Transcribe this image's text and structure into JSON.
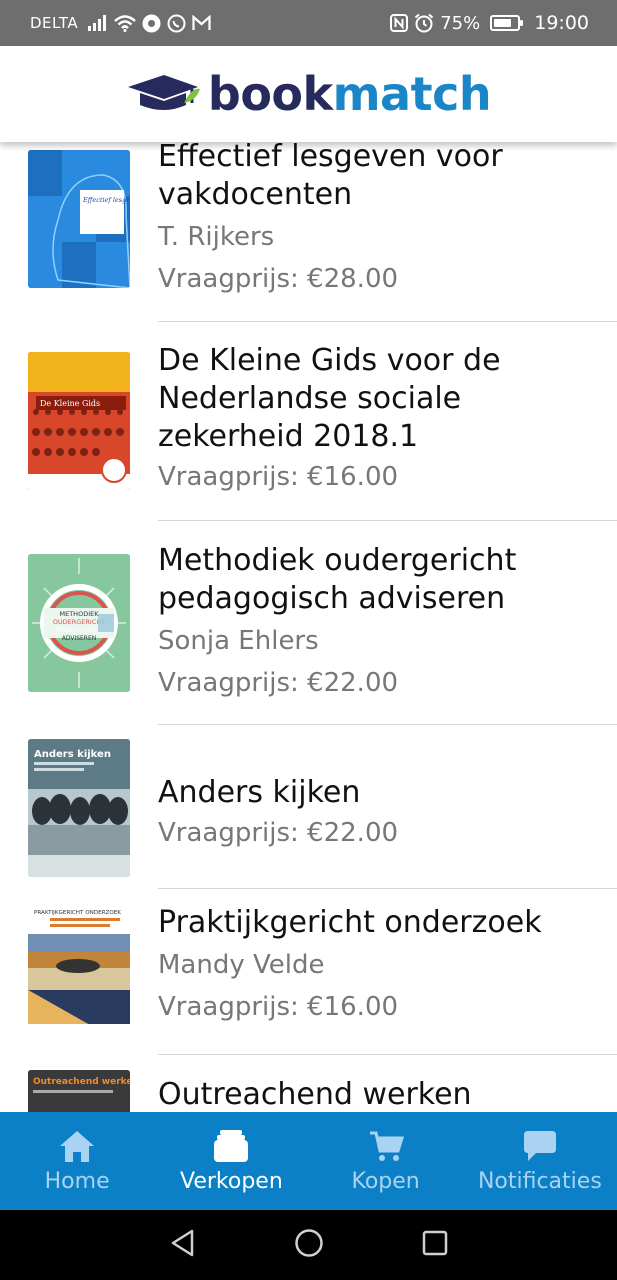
{
  "status_bar": {
    "carrier": "DELTA",
    "battery_percent": "75%",
    "battery_level": 0.75,
    "time": "19:00",
    "icons": [
      "signal-icon",
      "wifi-icon",
      "media-icon",
      "whatsapp-icon",
      "gmail-icon",
      "nfc-icon",
      "alarm-icon",
      "battery-icon"
    ]
  },
  "header": {
    "logo_part1": "book",
    "logo_part2": "match"
  },
  "books": [
    {
      "title": "Effectief lesgeven voor vakdocenten",
      "author": "T. Rijkers",
      "price": "Vraagprijs: €28.00",
      "cover": {
        "text": "Effectief lesgeven voor vakdocenten",
        "bg": "#1d7bd6"
      }
    },
    {
      "title": "De Kleine Gids voor de Nederlandse sociale zekerheid 2018.1",
      "author": "",
      "price": "Vraagprijs: €16.00",
      "cover": {
        "text": "De Kleine Gids",
        "bg": "#c5442b"
      }
    },
    {
      "title": "Methodiek oudergericht pedagogisch adviseren",
      "author": "Sonja Ehlers",
      "price": "Vraagprijs: €22.00",
      "cover": {
        "text_line1": "METHODIEK",
        "text_line2": "OUDERGERICHT",
        "text_line3": "PEDAGOGISCH",
        "text_line4": "ADVISEREN",
        "bg": "#7fc59a"
      }
    },
    {
      "title": "Anders kijken",
      "author": "",
      "price": "Vraagprijs: €22.00",
      "cover": {
        "text": "Anders kijken",
        "bg": "#8fa6ad"
      }
    },
    {
      "title": "Praktijkgericht onderzoek",
      "author": "Mandy Velde",
      "price": "Vraagprijs: €16.00",
      "cover": {
        "text": "PRAKTIJKGERICHT ONDERZOEK",
        "bg": "#ffffff"
      }
    },
    {
      "title": "Outreachend werken",
      "author": "",
      "price": "",
      "cover": {
        "text": "Outreachend werken",
        "bg": "#3a3a3a"
      }
    }
  ],
  "bottom_nav": {
    "items": [
      {
        "label": "Home",
        "icon": "home-icon",
        "active": false
      },
      {
        "label": "Verkopen",
        "icon": "sell-icon",
        "active": true
      },
      {
        "label": "Kopen",
        "icon": "cart-icon",
        "active": false
      },
      {
        "label": "Notificaties",
        "icon": "chat-icon",
        "active": false
      }
    ]
  },
  "colors": {
    "brand_dark": "#262a5c",
    "brand_blue": "#1a86c7",
    "nav_bg": "#0b80c6",
    "nav_inactive": "#a9d3f0",
    "status_bg": "#6e6e6e"
  }
}
